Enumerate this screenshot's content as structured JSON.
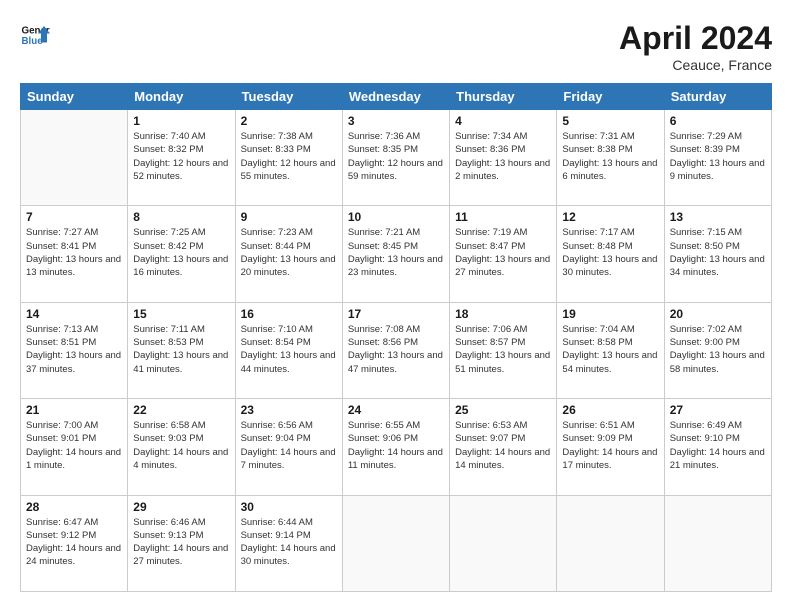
{
  "header": {
    "logo_general": "General",
    "logo_blue": "Blue",
    "month_title": "April 2024",
    "location": "Ceauce, France"
  },
  "weekdays": [
    "Sunday",
    "Monday",
    "Tuesday",
    "Wednesday",
    "Thursday",
    "Friday",
    "Saturday"
  ],
  "weeks": [
    [
      {
        "day": "",
        "sunrise": "",
        "sunset": "",
        "daylight": ""
      },
      {
        "day": "1",
        "sunrise": "Sunrise: 7:40 AM",
        "sunset": "Sunset: 8:32 PM",
        "daylight": "Daylight: 12 hours and 52 minutes."
      },
      {
        "day": "2",
        "sunrise": "Sunrise: 7:38 AM",
        "sunset": "Sunset: 8:33 PM",
        "daylight": "Daylight: 12 hours and 55 minutes."
      },
      {
        "day": "3",
        "sunrise": "Sunrise: 7:36 AM",
        "sunset": "Sunset: 8:35 PM",
        "daylight": "Daylight: 12 hours and 59 minutes."
      },
      {
        "day": "4",
        "sunrise": "Sunrise: 7:34 AM",
        "sunset": "Sunset: 8:36 PM",
        "daylight": "Daylight: 13 hours and 2 minutes."
      },
      {
        "day": "5",
        "sunrise": "Sunrise: 7:31 AM",
        "sunset": "Sunset: 8:38 PM",
        "daylight": "Daylight: 13 hours and 6 minutes."
      },
      {
        "day": "6",
        "sunrise": "Sunrise: 7:29 AM",
        "sunset": "Sunset: 8:39 PM",
        "daylight": "Daylight: 13 hours and 9 minutes."
      }
    ],
    [
      {
        "day": "7",
        "sunrise": "Sunrise: 7:27 AM",
        "sunset": "Sunset: 8:41 PM",
        "daylight": "Daylight: 13 hours and 13 minutes."
      },
      {
        "day": "8",
        "sunrise": "Sunrise: 7:25 AM",
        "sunset": "Sunset: 8:42 PM",
        "daylight": "Daylight: 13 hours and 16 minutes."
      },
      {
        "day": "9",
        "sunrise": "Sunrise: 7:23 AM",
        "sunset": "Sunset: 8:44 PM",
        "daylight": "Daylight: 13 hours and 20 minutes."
      },
      {
        "day": "10",
        "sunrise": "Sunrise: 7:21 AM",
        "sunset": "Sunset: 8:45 PM",
        "daylight": "Daylight: 13 hours and 23 minutes."
      },
      {
        "day": "11",
        "sunrise": "Sunrise: 7:19 AM",
        "sunset": "Sunset: 8:47 PM",
        "daylight": "Daylight: 13 hours and 27 minutes."
      },
      {
        "day": "12",
        "sunrise": "Sunrise: 7:17 AM",
        "sunset": "Sunset: 8:48 PM",
        "daylight": "Daylight: 13 hours and 30 minutes."
      },
      {
        "day": "13",
        "sunrise": "Sunrise: 7:15 AM",
        "sunset": "Sunset: 8:50 PM",
        "daylight": "Daylight: 13 hours and 34 minutes."
      }
    ],
    [
      {
        "day": "14",
        "sunrise": "Sunrise: 7:13 AM",
        "sunset": "Sunset: 8:51 PM",
        "daylight": "Daylight: 13 hours and 37 minutes."
      },
      {
        "day": "15",
        "sunrise": "Sunrise: 7:11 AM",
        "sunset": "Sunset: 8:53 PM",
        "daylight": "Daylight: 13 hours and 41 minutes."
      },
      {
        "day": "16",
        "sunrise": "Sunrise: 7:10 AM",
        "sunset": "Sunset: 8:54 PM",
        "daylight": "Daylight: 13 hours and 44 minutes."
      },
      {
        "day": "17",
        "sunrise": "Sunrise: 7:08 AM",
        "sunset": "Sunset: 8:56 PM",
        "daylight": "Daylight: 13 hours and 47 minutes."
      },
      {
        "day": "18",
        "sunrise": "Sunrise: 7:06 AM",
        "sunset": "Sunset: 8:57 PM",
        "daylight": "Daylight: 13 hours and 51 minutes."
      },
      {
        "day": "19",
        "sunrise": "Sunrise: 7:04 AM",
        "sunset": "Sunset: 8:58 PM",
        "daylight": "Daylight: 13 hours and 54 minutes."
      },
      {
        "day": "20",
        "sunrise": "Sunrise: 7:02 AM",
        "sunset": "Sunset: 9:00 PM",
        "daylight": "Daylight: 13 hours and 58 minutes."
      }
    ],
    [
      {
        "day": "21",
        "sunrise": "Sunrise: 7:00 AM",
        "sunset": "Sunset: 9:01 PM",
        "daylight": "Daylight: 14 hours and 1 minute."
      },
      {
        "day": "22",
        "sunrise": "Sunrise: 6:58 AM",
        "sunset": "Sunset: 9:03 PM",
        "daylight": "Daylight: 14 hours and 4 minutes."
      },
      {
        "day": "23",
        "sunrise": "Sunrise: 6:56 AM",
        "sunset": "Sunset: 9:04 PM",
        "daylight": "Daylight: 14 hours and 7 minutes."
      },
      {
        "day": "24",
        "sunrise": "Sunrise: 6:55 AM",
        "sunset": "Sunset: 9:06 PM",
        "daylight": "Daylight: 14 hours and 11 minutes."
      },
      {
        "day": "25",
        "sunrise": "Sunrise: 6:53 AM",
        "sunset": "Sunset: 9:07 PM",
        "daylight": "Daylight: 14 hours and 14 minutes."
      },
      {
        "day": "26",
        "sunrise": "Sunrise: 6:51 AM",
        "sunset": "Sunset: 9:09 PM",
        "daylight": "Daylight: 14 hours and 17 minutes."
      },
      {
        "day": "27",
        "sunrise": "Sunrise: 6:49 AM",
        "sunset": "Sunset: 9:10 PM",
        "daylight": "Daylight: 14 hours and 21 minutes."
      }
    ],
    [
      {
        "day": "28",
        "sunrise": "Sunrise: 6:47 AM",
        "sunset": "Sunset: 9:12 PM",
        "daylight": "Daylight: 14 hours and 24 minutes."
      },
      {
        "day": "29",
        "sunrise": "Sunrise: 6:46 AM",
        "sunset": "Sunset: 9:13 PM",
        "daylight": "Daylight: 14 hours and 27 minutes."
      },
      {
        "day": "30",
        "sunrise": "Sunrise: 6:44 AM",
        "sunset": "Sunset: 9:14 PM",
        "daylight": "Daylight: 14 hours and 30 minutes."
      },
      {
        "day": "",
        "sunrise": "",
        "sunset": "",
        "daylight": ""
      },
      {
        "day": "",
        "sunrise": "",
        "sunset": "",
        "daylight": ""
      },
      {
        "day": "",
        "sunrise": "",
        "sunset": "",
        "daylight": ""
      },
      {
        "day": "",
        "sunrise": "",
        "sunset": "",
        "daylight": ""
      }
    ]
  ]
}
